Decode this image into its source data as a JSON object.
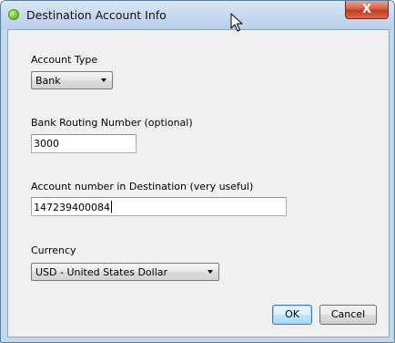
{
  "window": {
    "title": "Destination Account Info",
    "close_glyph": "X"
  },
  "form": {
    "account_type": {
      "label": "Account Type",
      "value": "Bank"
    },
    "routing_number": {
      "label": "Bank Routing Number (optional)",
      "value": "3000"
    },
    "account_number": {
      "label": "Account number in Destination (very useful)",
      "value": "147239400084"
    },
    "currency": {
      "label": "Currency",
      "value": "USD - United States Dollar"
    }
  },
  "buttons": {
    "ok_label": "OK",
    "cancel_label": "Cancel"
  },
  "icons": {
    "app": "green-sphere-icon",
    "close": "close-icon",
    "dropdown": "chevron-down-icon",
    "pointer": "mouse-pointer-icon"
  }
}
